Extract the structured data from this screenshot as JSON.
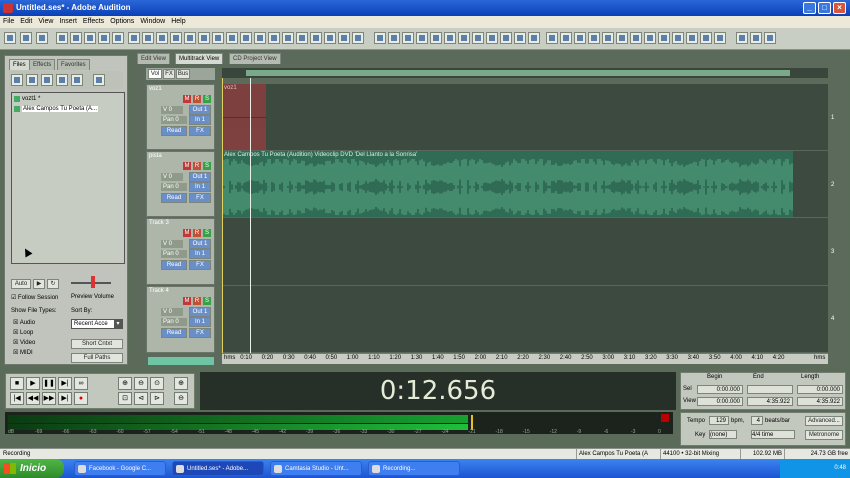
{
  "window": {
    "title": "Untitled.ses* - Adobe Audition"
  },
  "menu": [
    "File",
    "Edit",
    "View",
    "Insert",
    "Effects",
    "Options",
    "Window",
    "Help"
  ],
  "left_panel": {
    "tabs": [
      "Files",
      "Effects",
      "Favorites"
    ],
    "files": [
      "vozt1 *",
      "Alex Campos   Tu Poeta (A..."
    ],
    "controls": {
      "auto_play": "Auto",
      "follow_session": "Follow Session",
      "preview_volume": "Preview Volume"
    },
    "show_types_label": "Show File Types:",
    "types": [
      "Audio",
      "Loop",
      "Video",
      "MIDI"
    ],
    "sort_label": "Sort By:",
    "sort_value": "Recent Acce",
    "short_label_btn": "Short Cntxt",
    "full_path_btn": "Full Paths"
  },
  "view_tabs": [
    "Edit View",
    "Multitrack View",
    "CD Project View"
  ],
  "track_mode_tabs": [
    "Vol",
    "FX",
    "Bus"
  ],
  "tracks": [
    {
      "name": "voz1",
      "vol": "V 0",
      "pan": "Pan 0",
      "out": "Out 1",
      "in": "In 1",
      "read": "Read",
      "fx": "FX",
      "num": "1"
    },
    {
      "name": "pista",
      "vol": "V 0",
      "pan": "Pan 0",
      "out": "Out 1",
      "in": "In 1",
      "read": "Read",
      "fx": "FX",
      "num": "2"
    },
    {
      "name": "Track 3",
      "vol": "V 0",
      "pan": "Pan 0",
      "out": "Out 1",
      "in": "In 1",
      "read": "Read",
      "fx": "FX",
      "num": "3"
    },
    {
      "name": "Track 4",
      "vol": "V 0",
      "pan": "Pan 0",
      "out": "Out 1",
      "in": "In 1",
      "read": "Read",
      "fx": "FX",
      "num": "4"
    }
  ],
  "mrs": [
    "M",
    "R",
    "S"
  ],
  "clips": {
    "voz": "voz1",
    "song": "Alex Campos   Tu Poeta (Audition)  Videoclip  DVD 'Del Llanto a la Sonrisa'"
  },
  "ruler": [
    "hms",
    "0:10",
    "0:20",
    "0:30",
    "0:40",
    "0:50",
    "1:00",
    "1:10",
    "1:20",
    "1:30",
    "1:40",
    "1:50",
    "2:00",
    "2:10",
    "2:20",
    "2:30",
    "2:40",
    "2:50",
    "3:00",
    "3:10",
    "3:20",
    "3:30",
    "3:40",
    "3:50",
    "4:00",
    "4:10",
    "4:20",
    "hms"
  ],
  "time_display": "0:12.656",
  "selection": {
    "headers": [
      "Begin",
      "End",
      "Length"
    ],
    "sel_label": "Sel",
    "view_label": "View",
    "sel": [
      "0:00.000",
      "",
      "0:00.000"
    ],
    "view": [
      "0:00.000",
      "4:35.922",
      "4:35.922"
    ]
  },
  "tempo": {
    "tempo_label": "Tempo",
    "tempo_value": "129",
    "bpm_label": "bpm,",
    "beats_value": "4",
    "beats_label": "beats/bar",
    "advanced": "Advanced...",
    "key_label": "Key",
    "key_value": "(none)",
    "time_sig": "4/4 time",
    "metronome": "Metronome"
  },
  "level_ticks": [
    "dB",
    "-69",
    "-66",
    "-63",
    "-60",
    "-57",
    "-54",
    "-51",
    "-48",
    "-45",
    "-42",
    "-39",
    "-36",
    "-33",
    "-30",
    "-27",
    "-24",
    "-21",
    "-18",
    "-15",
    "-12",
    "-9",
    "-6",
    "-3",
    "0"
  ],
  "status": {
    "left": "Recording",
    "file": "Alex Campos   Tu Poeta (A",
    "format": "44100 • 32-bit Mixing",
    "size": "102.92 MB",
    "free": "24.73 GB free"
  },
  "taskbar": {
    "start": "Inicio",
    "tasks": [
      "Facebook - Google C...",
      "Untitled.ses* - Adobe...",
      "Camtasia Studio - Unt...",
      "Recording..."
    ],
    "clock": "0:48"
  },
  "colors": {
    "track_bg": "#3d4a3f",
    "wave": "#5aa885",
    "clip": "#2f6b55",
    "voz_clip": "#8a3f3f",
    "level": "#1fbf3a"
  }
}
